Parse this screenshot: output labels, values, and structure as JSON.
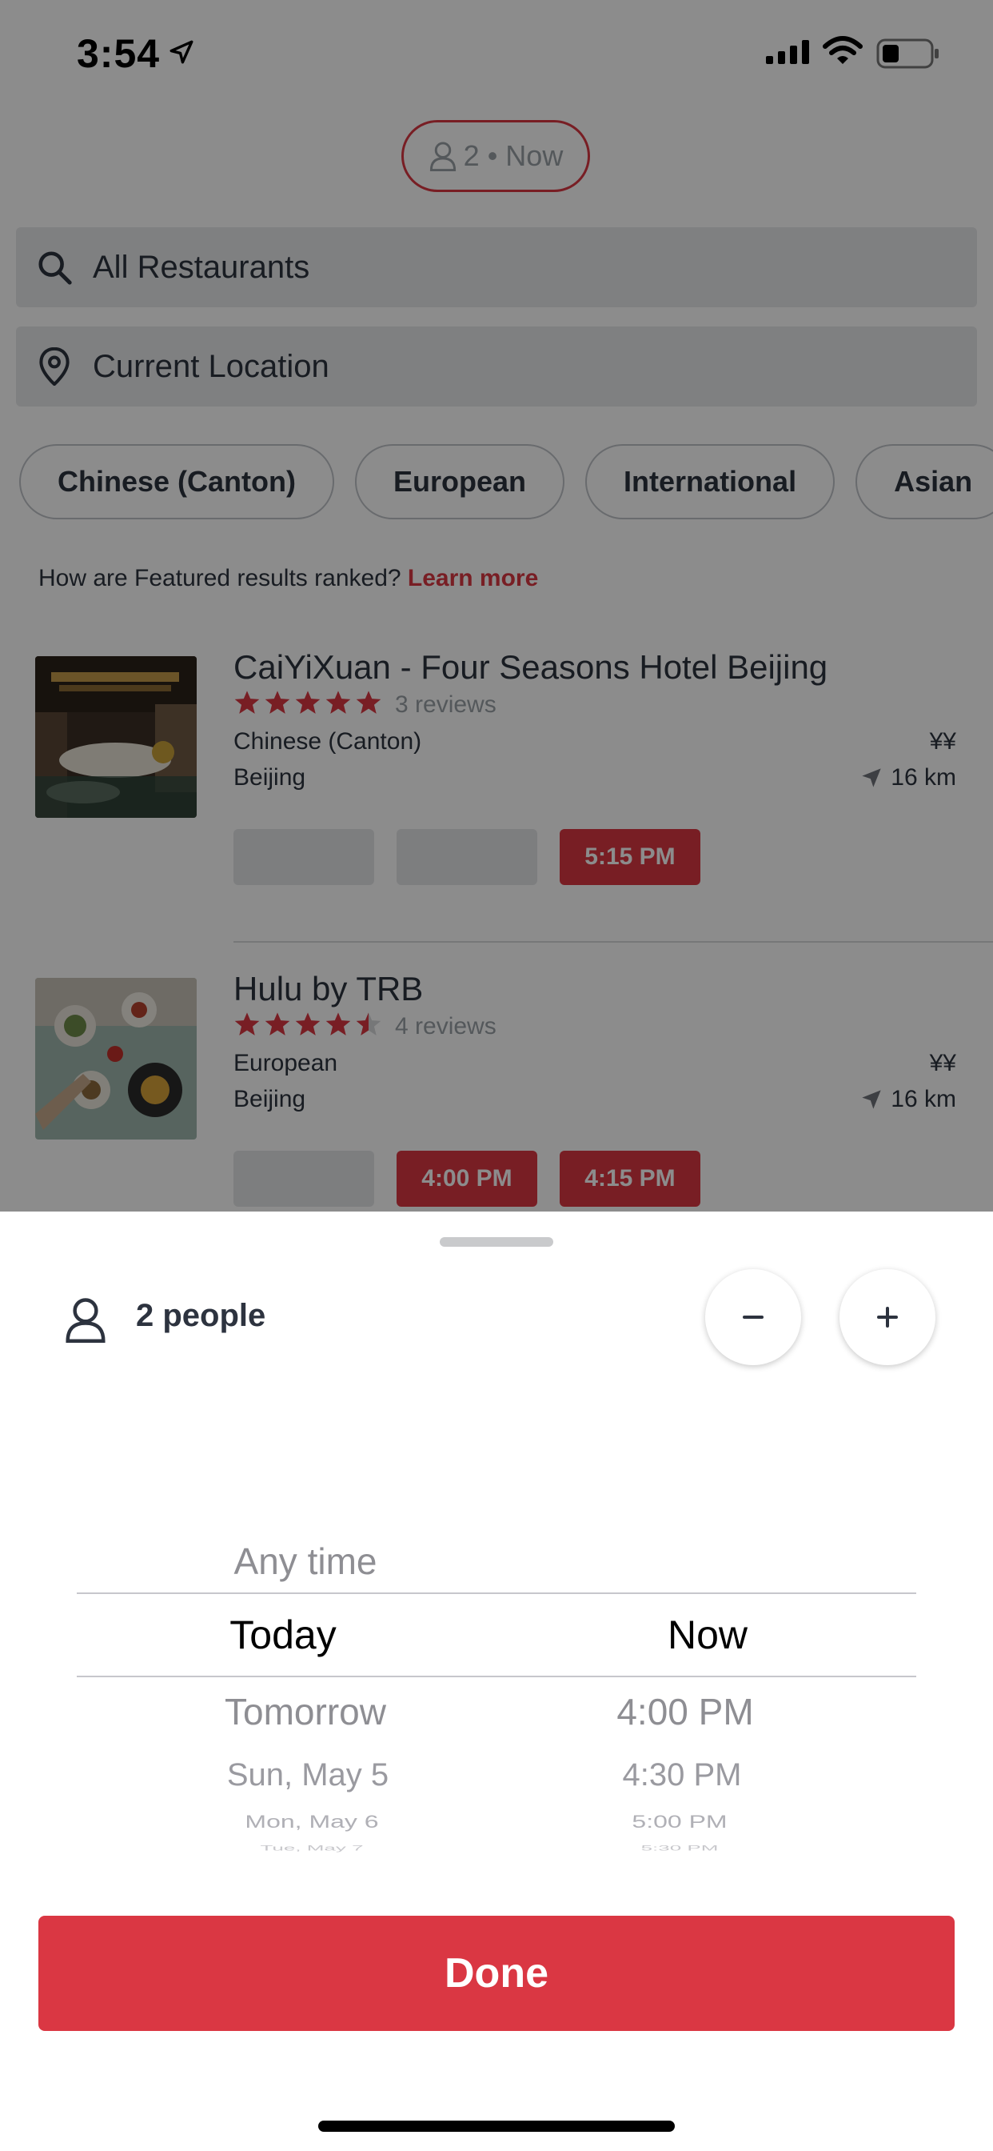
{
  "status_bar": {
    "time": "3:54"
  },
  "party_pill": {
    "label": "2 • Now"
  },
  "search": {
    "value": "All Restaurants"
  },
  "location": {
    "value": "Current Location"
  },
  "cuisines": [
    "Chinese (Canton)",
    "European",
    "International",
    "Asian"
  ],
  "featured": {
    "question": "How are Featured results ranked?",
    "link": "Learn more"
  },
  "restaurants": [
    {
      "name": "CaiYiXuan - Four Seasons Hotel Beijing",
      "rating": 5,
      "reviews": "3 reviews",
      "cuisine": "Chinese (Canton)",
      "city": "Beijing",
      "price": "¥¥",
      "distance": "16 km",
      "slots": [
        "",
        "",
        "5:15 PM"
      ]
    },
    {
      "name": "Hulu by TRB",
      "rating": 4.5,
      "reviews": "4 reviews",
      "cuisine": "European",
      "city": "Beijing",
      "price": "¥¥",
      "distance": "16 km",
      "slots": [
        "",
        "4:00 PM",
        "4:15 PM"
      ]
    }
  ],
  "sheet": {
    "people_label": "2 people",
    "date_options": [
      "Any time",
      "Today",
      "Tomorrow",
      "Sun, May 5",
      "Mon, May 6",
      "Tue, May 7"
    ],
    "selected_date": "Today",
    "time_options": [
      "Now",
      "4:00 PM",
      "4:30 PM",
      "5:00 PM",
      "5:30 PM"
    ],
    "selected_time": "Now",
    "done_label": "Done"
  },
  "colors": {
    "accent": "#da3743",
    "text": "#2d333f",
    "field_bg": "#e8e9eb"
  },
  "icons": [
    "location-arrow-icon",
    "signal-icon",
    "wifi-icon",
    "battery-icon",
    "person-icon",
    "search-icon",
    "map-pin-icon",
    "star-icon",
    "navigation-arrow-icon",
    "minus-icon",
    "plus-icon"
  ]
}
